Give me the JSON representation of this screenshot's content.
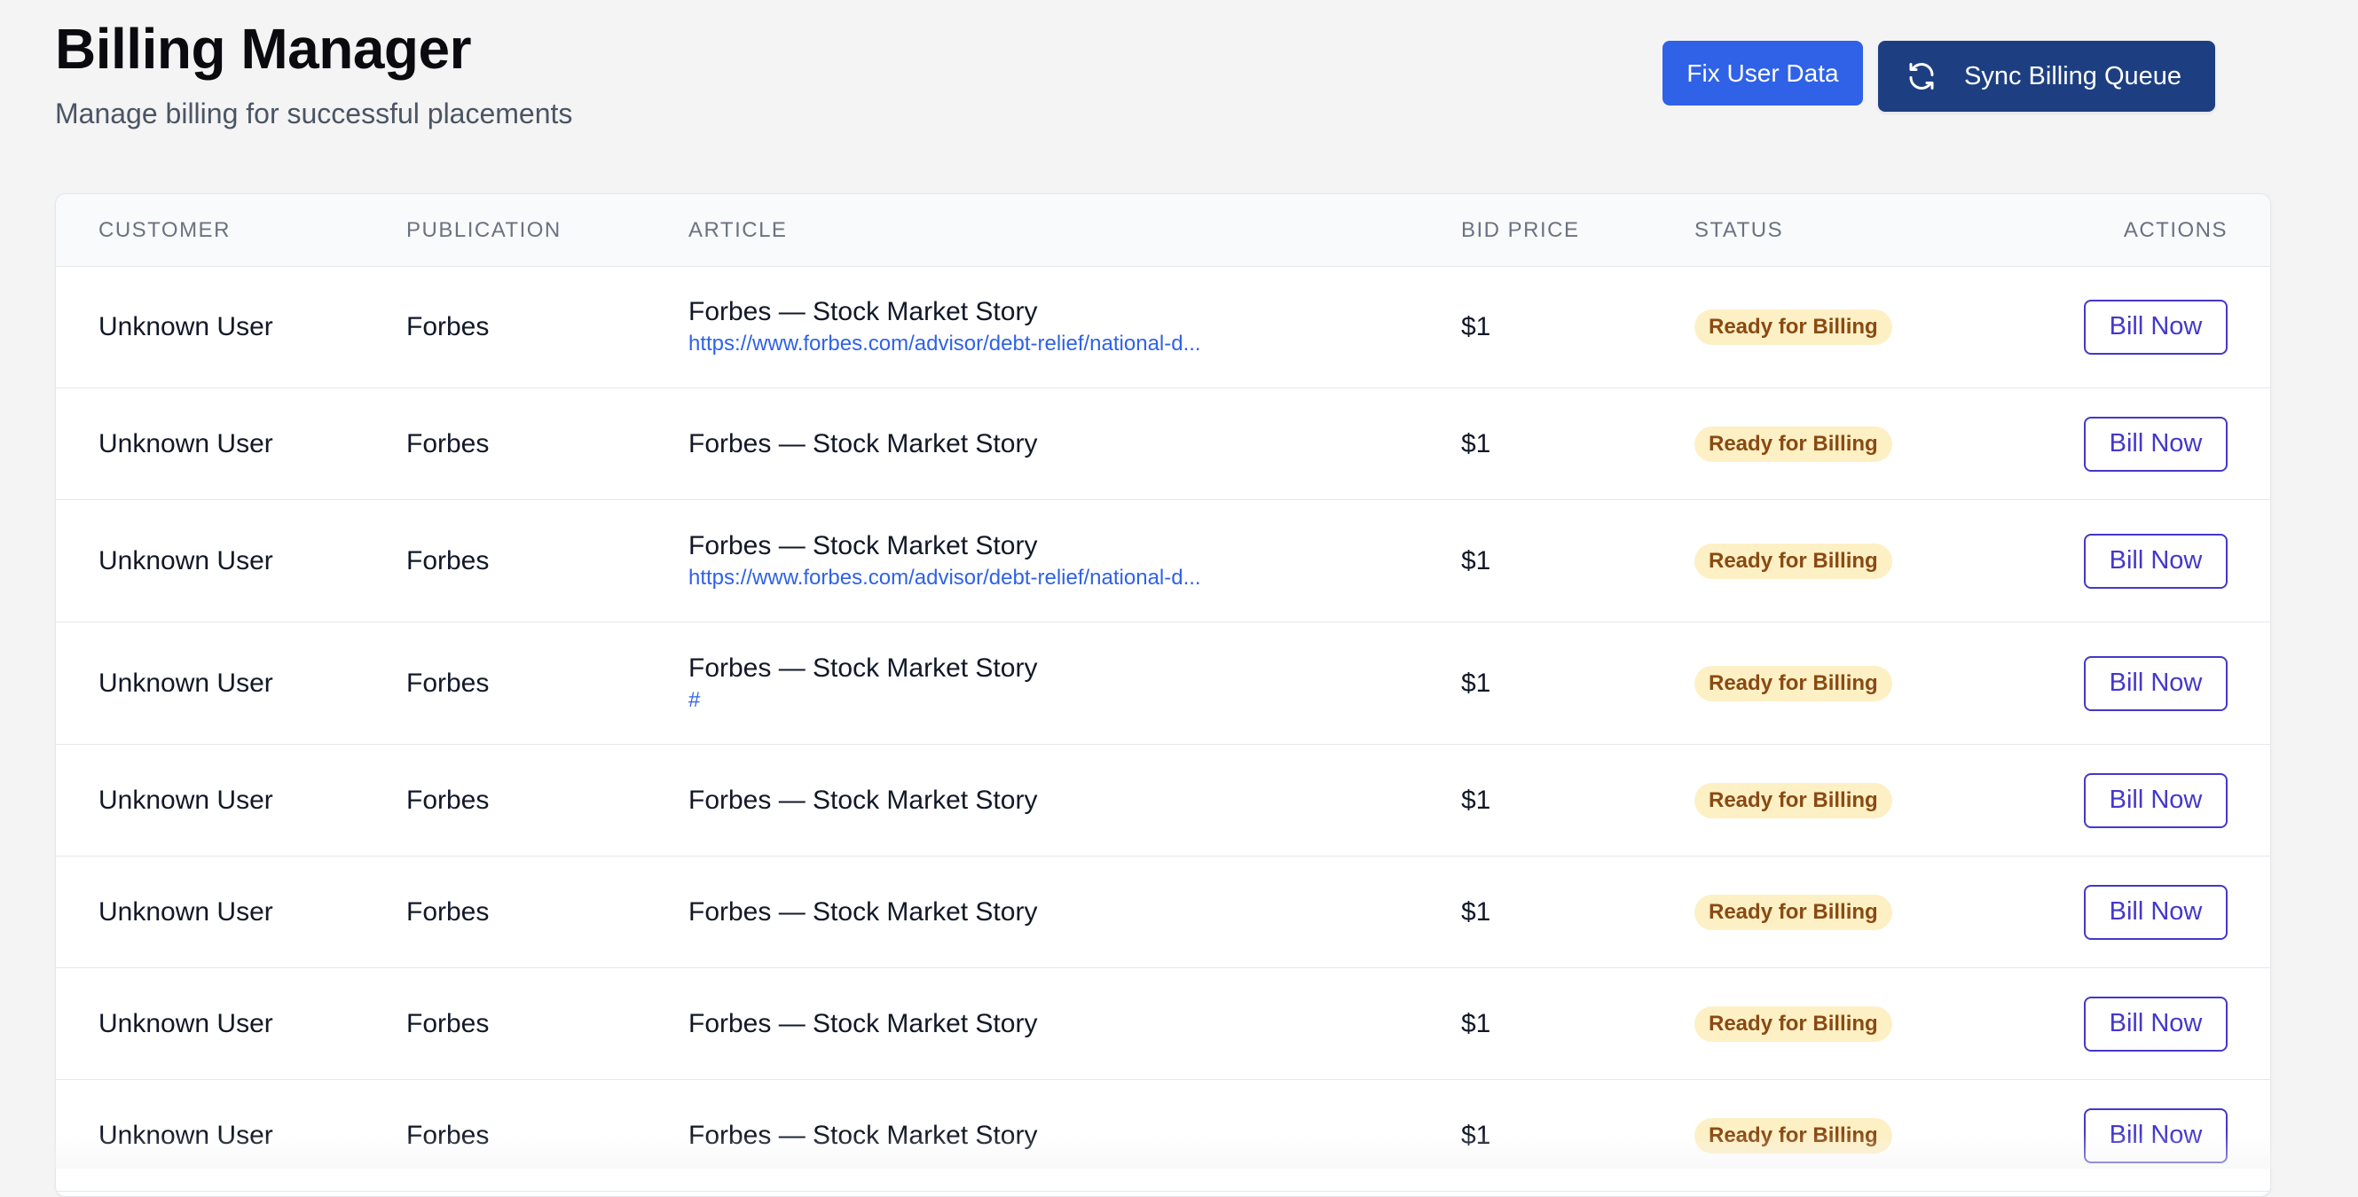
{
  "header": {
    "title": "Billing Manager",
    "subtitle": "Manage billing for successful placements",
    "fix_button_label": "Fix User Data",
    "sync_button_label": "Sync Billing Queue"
  },
  "table": {
    "columns": [
      "CUSTOMER",
      "PUBLICATION",
      "ARTICLE",
      "BID PRICE",
      "STATUS",
      "ACTIONS"
    ],
    "rows": [
      {
        "customer": "Unknown User",
        "publication": "Forbes",
        "article_title": "Forbes — Stock Market Story",
        "article_link": "https://www.forbes.com/advisor/debt-relief/national-d...",
        "bid_price": "$1",
        "status": "Ready for Billing",
        "action": "Bill Now"
      },
      {
        "customer": "Unknown User",
        "publication": "Forbes",
        "article_title": "Forbes — Stock Market Story",
        "article_link": "",
        "bid_price": "$1",
        "status": "Ready for Billing",
        "action": "Bill Now"
      },
      {
        "customer": "Unknown User",
        "publication": "Forbes",
        "article_title": "Forbes — Stock Market Story",
        "article_link": "https://www.forbes.com/advisor/debt-relief/national-d...",
        "bid_price": "$1",
        "status": "Ready for Billing",
        "action": "Bill Now"
      },
      {
        "customer": "Unknown User",
        "publication": "Forbes",
        "article_title": "Forbes — Stock Market Story",
        "article_link": "#",
        "bid_price": "$1",
        "status": "Ready for Billing",
        "action": "Bill Now"
      },
      {
        "customer": "Unknown User",
        "publication": "Forbes",
        "article_title": "Forbes — Stock Market Story",
        "article_link": "",
        "bid_price": "$1",
        "status": "Ready for Billing",
        "action": "Bill Now"
      },
      {
        "customer": "Unknown User",
        "publication": "Forbes",
        "article_title": "Forbes — Stock Market Story",
        "article_link": "",
        "bid_price": "$1",
        "status": "Ready for Billing",
        "action": "Bill Now"
      },
      {
        "customer": "Unknown User",
        "publication": "Forbes",
        "article_title": "Forbes — Stock Market Story",
        "article_link": "",
        "bid_price": "$1",
        "status": "Ready for Billing",
        "action": "Bill Now"
      },
      {
        "customer": "Unknown User",
        "publication": "Forbes",
        "article_title": "Forbes — Stock Market Story",
        "article_link": "",
        "bid_price": "$1",
        "status": "Ready for Billing",
        "action": "Bill Now"
      }
    ]
  },
  "icons": {
    "sync": "refresh-icon"
  },
  "colors": {
    "primary_button": "#2f62e6",
    "sync_button": "#1d3f82",
    "link": "#2f62e6",
    "badge_bg": "#fdf0c5",
    "badge_text": "#8a4a12",
    "bill_button": "#4338ca"
  }
}
